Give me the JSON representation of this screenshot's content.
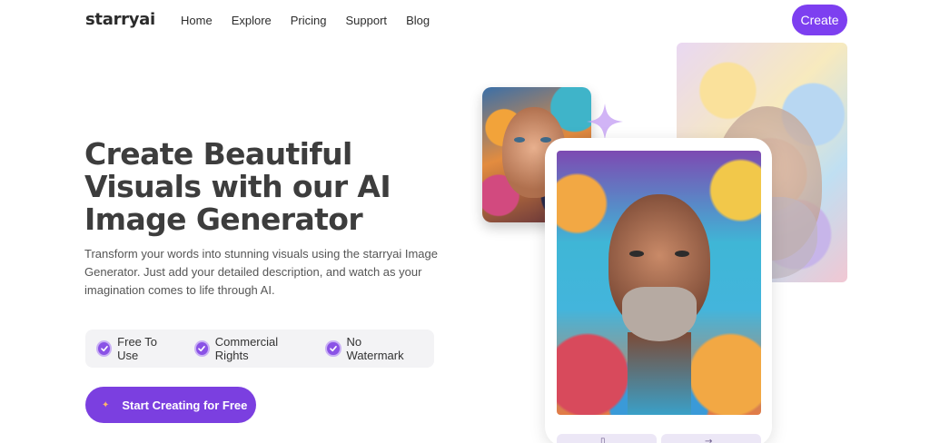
{
  "header": {
    "logo": "starryai",
    "nav": [
      "Home",
      "Explore",
      "Pricing",
      "Support",
      "Blog"
    ],
    "create_label": "Create"
  },
  "hero": {
    "title": "Create Beautiful Visuals with our AI Image Generator",
    "description": "Transform your words into stunning visuals using the starryai Image Generator. Just add your detailed description, and watch as your imagination comes to life through AI.",
    "features": [
      "Free To Use",
      "Commercial Rights",
      "No Watermark"
    ],
    "cta_label": "Start Creating for Free"
  },
  "colors": {
    "accent": "#7d3ff0",
    "feature_bg": "#f3f3f5"
  },
  "icons": {
    "feature": "check-badge-icon",
    "cta": "sparkle-icon",
    "decoration": "four-point-star-icon"
  }
}
